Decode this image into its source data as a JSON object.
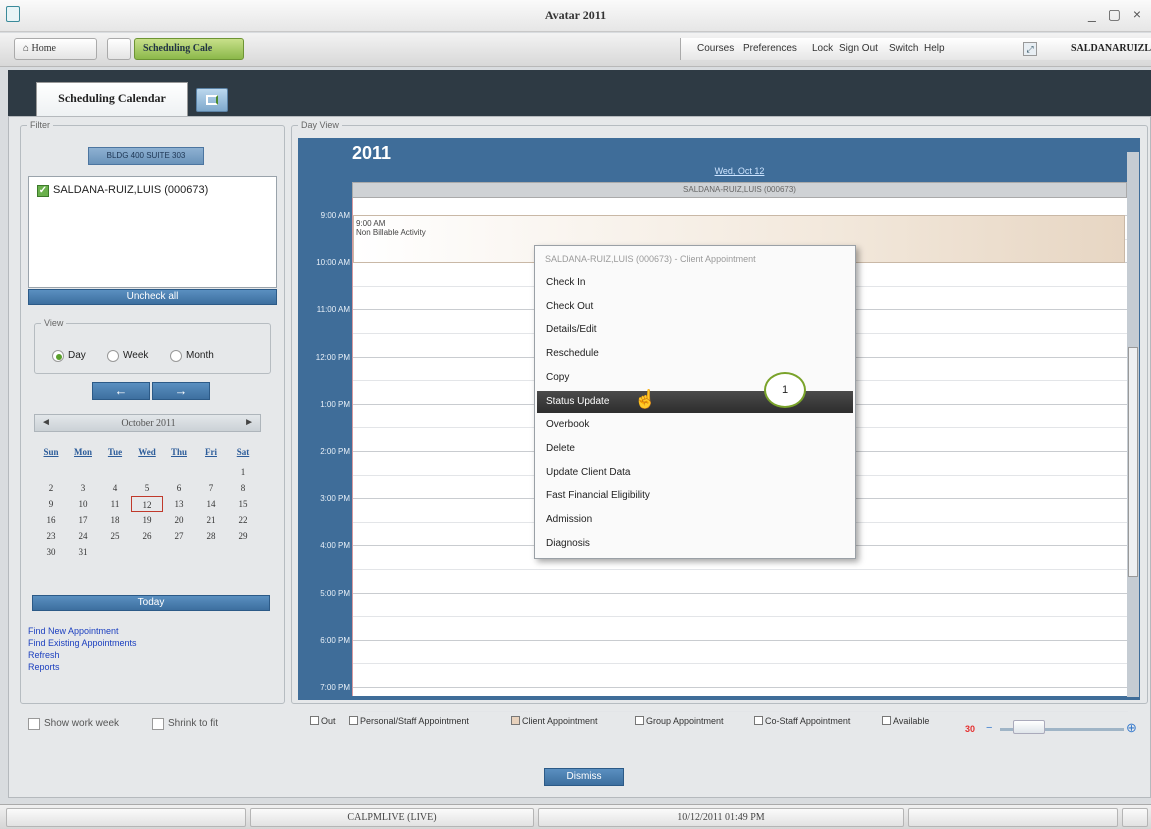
{
  "window": {
    "title": "Avatar 2011",
    "controls": "_ ▢ ×"
  },
  "navbar": {
    "home_label": "Home",
    "tab_label": "Scheduling Cale",
    "links": [
      "Courses",
      "Preferences",
      "Lock",
      "Sign Out",
      "Switch",
      "Help"
    ],
    "user": "SALDANARUIZL"
  },
  "tabs": {
    "active": "Scheduling Calendar"
  },
  "filter": {
    "legend": "Filter",
    "building_button": "BLDG 400 SUITE 303",
    "staff": [
      {
        "label": "SALDANA-RUIZ,LUIS (000673)",
        "checked": true
      }
    ],
    "uncheck_all": "Uncheck all",
    "view_legend": "View",
    "view_options": [
      {
        "label": "Day",
        "selected": true
      },
      {
        "label": "Week",
        "selected": false
      },
      {
        "label": "Month",
        "selected": false
      }
    ],
    "prev_arrow": "←",
    "next_arrow": "→",
    "calendar": {
      "month_label": "October 2011",
      "prev": "◄",
      "next": "►",
      "weekdays": [
        "Sun",
        "Mon",
        "Tue",
        "Wed",
        "Thu",
        "Fri",
        "Sat"
      ],
      "weeks": [
        [
          "",
          "",
          "",
          "",
          "",
          "",
          "1"
        ],
        [
          "2",
          "3",
          "4",
          "5",
          "6",
          "7",
          "8"
        ],
        [
          "9",
          "10",
          "11",
          "12",
          "13",
          "14",
          "15"
        ],
        [
          "16",
          "17",
          "18",
          "19",
          "20",
          "21",
          "22"
        ],
        [
          "23",
          "24",
          "25",
          "26",
          "27",
          "28",
          "29"
        ],
        [
          "30",
          "31",
          "",
          "",
          "",
          "",
          ""
        ]
      ],
      "selected": "12"
    },
    "today_button": "Today",
    "links": [
      "Find New Appointment",
      "Find Existing Appointments",
      "Refresh",
      "Reports"
    ]
  },
  "bottom_options": {
    "show_work_week": "Show work week",
    "shrink_to_fit": "Shrink to fit"
  },
  "dayview": {
    "legend": "Day View",
    "year": "2011",
    "date": "Wed, Oct 12",
    "column_header": "SALDANA-RUIZ,LUIS (000673)",
    "times": [
      "9:00 AM",
      "10:00 AM",
      "11:00 AM",
      "12:00 PM",
      "1:00 PM",
      "2:00 PM",
      "3:00 PM",
      "4:00 PM",
      "5:00 PM",
      "6:00 PM",
      "7:00 PM"
    ],
    "appointment": {
      "time": "9:00 AM",
      "title": "Non Billable Activity"
    }
  },
  "context_menu": {
    "header": "SALDANA-RUIZ,LUIS (000673) - Client Appointment",
    "items": [
      "Check In",
      "Check Out",
      "Details/Edit",
      "Reschedule",
      "Copy",
      "Status Update",
      "Overbook",
      "Delete",
      "Update Client Data",
      "Fast Financial Eligibility",
      "Admission",
      "Diagnosis"
    ],
    "highlighted": "Status Update"
  },
  "callout": "1",
  "legend_items": [
    "Out",
    "Personal/Staff Appointment",
    "Client Appointment",
    "Group Appointment",
    "Co-Staff Appointment",
    "Available"
  ],
  "legend_colors": [
    "#ffffff",
    "#ffffff",
    "#e8d2bd",
    "#ffffff",
    "#ffffff",
    "#ffffff"
  ],
  "zoom": {
    "value": "30",
    "minus": "−",
    "plus": "⊕"
  },
  "dismiss_button": "Dismiss",
  "status": {
    "environment": "CALPMLIVE (LIVE)",
    "datetime": "10/12/2011 01:49 PM"
  },
  "colors": {
    "accent_green": "#8bb84a",
    "dayview_blue": "#3f6d99",
    "menu_highlight": "#2d2d2d"
  }
}
